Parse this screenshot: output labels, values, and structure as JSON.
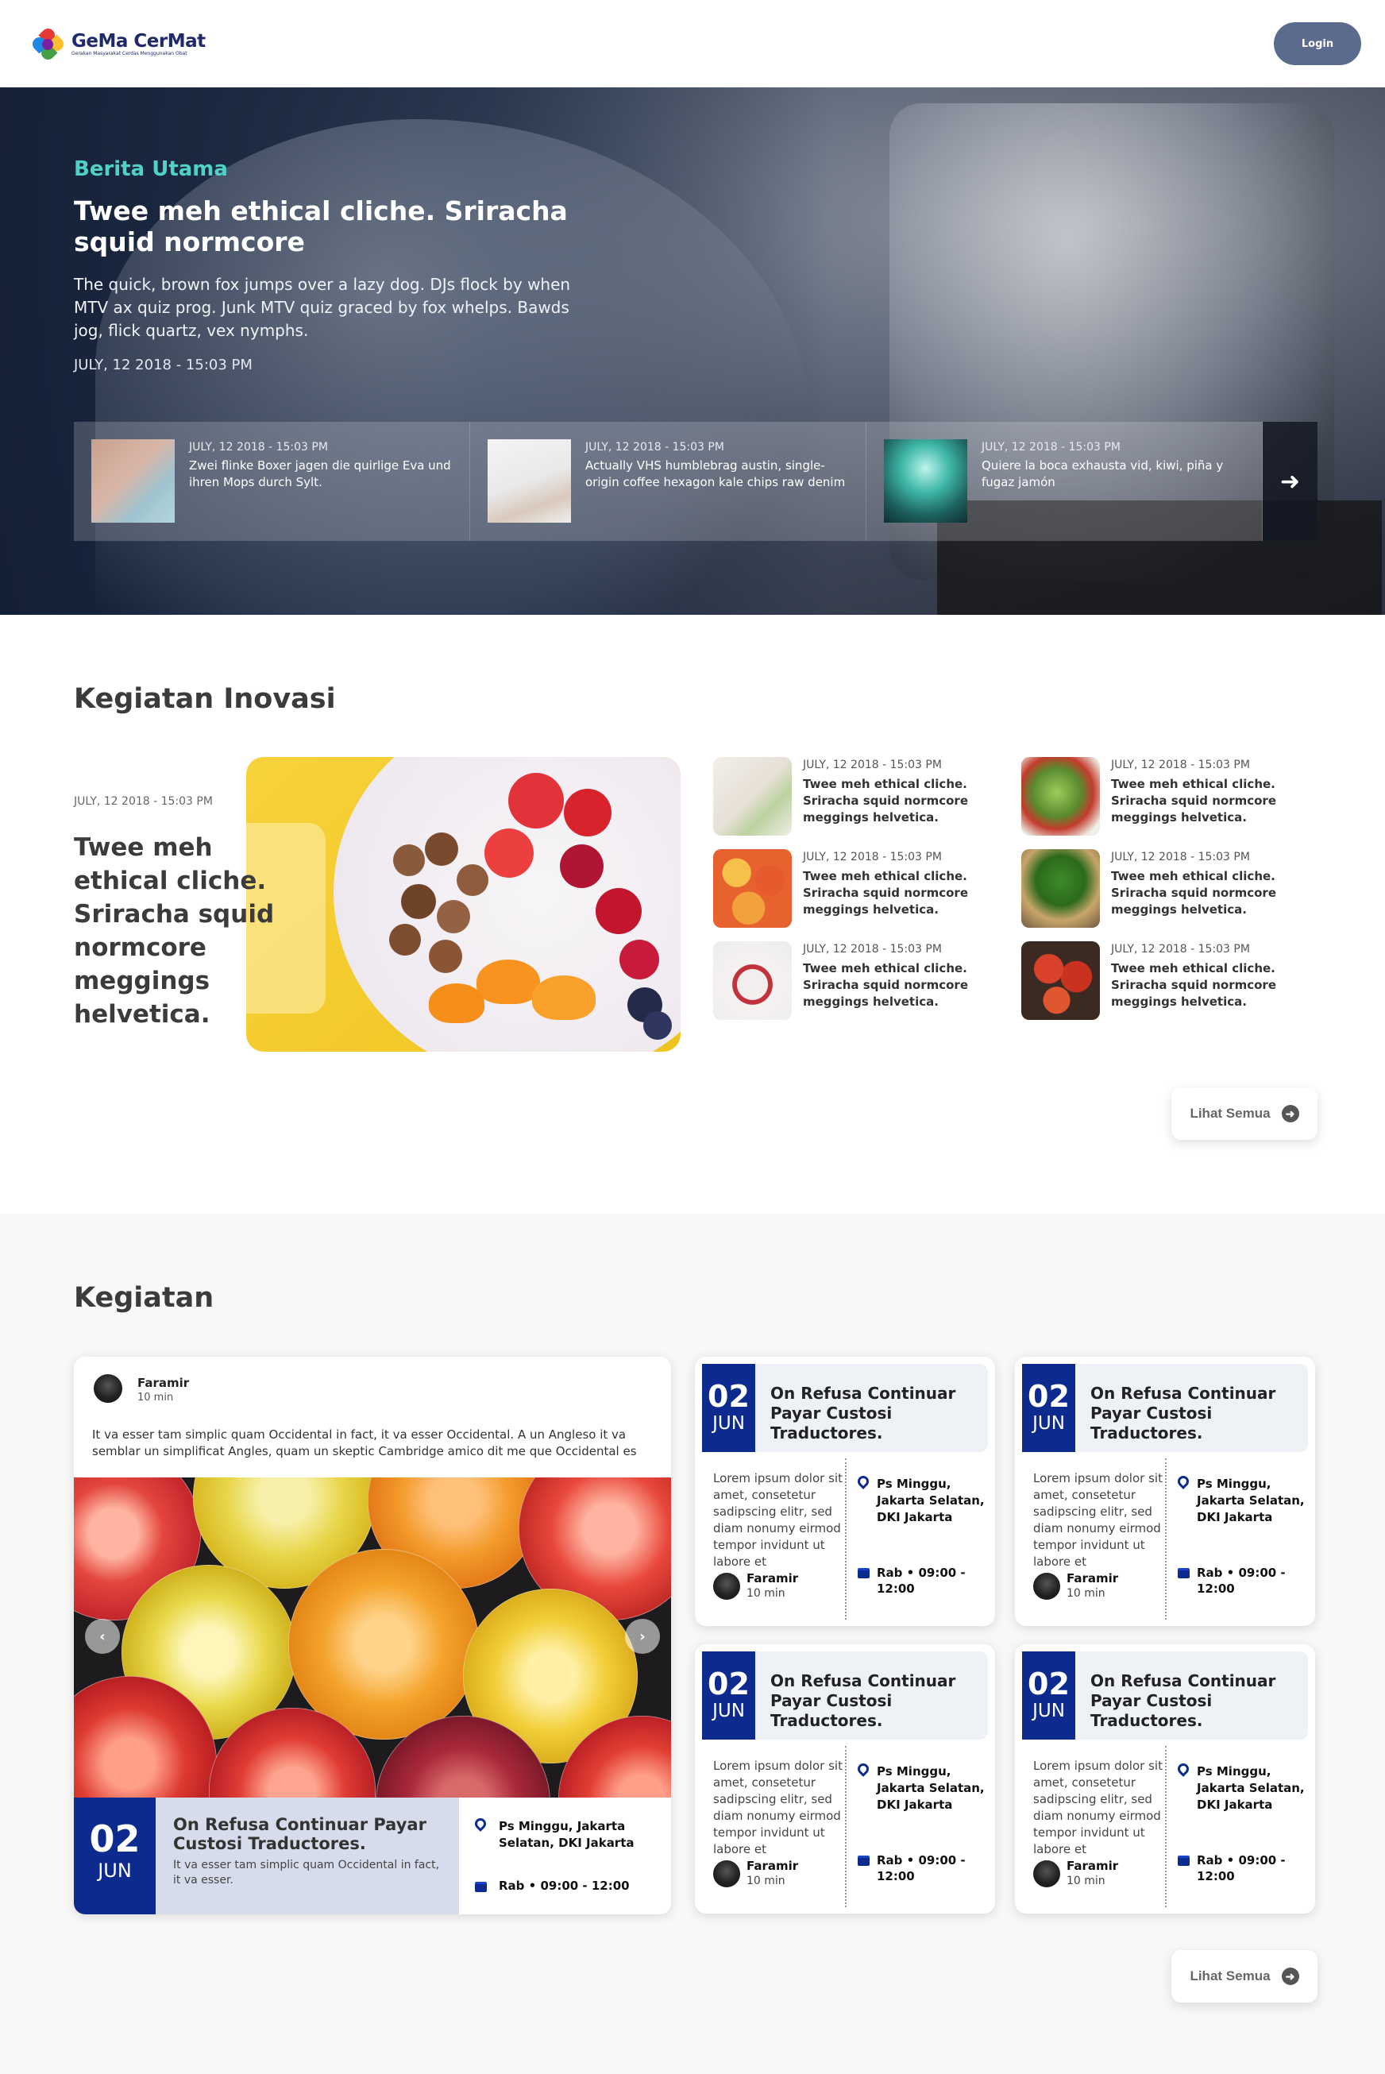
{
  "header": {
    "logo_name": "GeMa CerMat",
    "logo_tagline": "Gerakan Masyarakat Cerdas Menggunakan Obat",
    "login_label": "Login"
  },
  "hero": {
    "kicker": "Berita Utama",
    "title": "Twee meh ethical cliche. Sriracha squid normcore",
    "description": "The quick, brown fox jumps over a lazy dog. DJs flock by when MTV ax quiz prog. Junk MTV quiz graced by fox whelps. Bawds jog, flick quartz, vex nymphs.",
    "date": "JULY, 12 2018 - 15:03 PM",
    "strip": [
      {
        "date": "JULY, 12 2018 - 15:03 PM",
        "text": "Zwei flinke Boxer jagen die quirlige Eva und ihren Mops durch Sylt."
      },
      {
        "date": "JULY, 12 2018 - 15:03 PM",
        "text": "Actually VHS humblebrag austin, single-origin coffee hexagon kale chips raw denim"
      },
      {
        "date": "JULY, 12 2018 - 15:03 PM",
        "text": "Quiere la boca exhausta vid, kiwi, piña y fugaz jamón"
      }
    ],
    "next_icon": "arrow-right-icon"
  },
  "inovasi": {
    "title": "Kegiatan Inovasi",
    "featured": {
      "date": "JULY, 12 2018 - 15:03 PM",
      "title": "Twee meh ethical cliche. Sriracha squid normcore meggings helvetica."
    },
    "items": [
      {
        "date": "JULY, 12 2018 - 15:03 PM",
        "text": "Twee meh ethical cliche. Sriracha squid normcore meggings helvetica."
      },
      {
        "date": "JULY, 12 2018 - 15:03 PM",
        "text": "Twee meh ethical cliche. Sriracha squid normcore meggings helvetica."
      },
      {
        "date": "JULY, 12 2018 - 15:03 PM",
        "text": "Twee meh ethical cliche. Sriracha squid normcore meggings helvetica."
      },
      {
        "date": "JULY, 12 2018 - 15:03 PM",
        "text": "Twee meh ethical cliche. Sriracha squid normcore meggings helvetica."
      },
      {
        "date": "JULY, 12 2018 - 15:03 PM",
        "text": "Twee meh ethical cliche. Sriracha squid normcore meggings helvetica."
      },
      {
        "date": "JULY, 12 2018 - 15:03 PM",
        "text": "Twee meh ethical cliche. Sriracha squid normcore meggings helvetica."
      }
    ],
    "see_all": "Lihat Semua"
  },
  "kegiatan": {
    "title": "Kegiatan",
    "featured": {
      "author": "Faramir",
      "read_time": "10 min",
      "text": "It va esser tam simplic quam Occidental in fact, it va esser Occidental. A un Angleso it va semblar un simplificat Angles, quam un skeptic Cambridge amico dit me que Occidental es",
      "day": "02",
      "month": "JUN",
      "event_title": "On Refusa Continuar Payar Custosi Traductores.",
      "event_sub": "It va esser tam simplic quam Occidental in fact, it va esser.",
      "location": "Ps Minggu, Jakarta Selatan, DKI Jakarta",
      "time": "Rab • 09:00 - 12:00"
    },
    "events": [
      {
        "day": "02",
        "month": "JUN",
        "title": "On Refusa Continuar Payar Custosi Traductores.",
        "desc": "Lorem ipsum dolor sit amet, consetetur sadipscing elitr, sed diam nonumy eirmod tempor invidunt ut labore et",
        "author": "Faramir",
        "read_time": "10 min",
        "location": "Ps Minggu, Jakarta Selatan, DKI Jakarta",
        "time": "Rab • 09:00 - 12:00"
      },
      {
        "day": "02",
        "month": "JUN",
        "title": "On Refusa Continuar Payar Custosi Traductores.",
        "desc": "Lorem ipsum dolor sit amet, consetetur sadipscing elitr, sed diam nonumy eirmod tempor invidunt ut labore et",
        "author": "Faramir",
        "read_time": "10 min",
        "location": "Ps Minggu, Jakarta Selatan, DKI Jakarta",
        "time": "Rab • 09:00 - 12:00"
      },
      {
        "day": "02",
        "month": "JUN",
        "title": "On Refusa Continuar Payar Custosi Traductores.",
        "desc": "Lorem ipsum dolor sit amet, consetetur sadipscing elitr, sed diam nonumy eirmod tempor invidunt ut labore et",
        "author": "Faramir",
        "read_time": "10 min",
        "location": "Ps Minggu, Jakarta Selatan, DKI Jakarta",
        "time": "Rab • 09:00 - 12:00"
      },
      {
        "day": "02",
        "month": "JUN",
        "title": "On Refusa Continuar Payar Custosi Traductores.",
        "desc": "Lorem ipsum dolor sit amet, consetetur sadipscing elitr, sed diam nonumy eirmod tempor invidunt ut labore et",
        "author": "Faramir",
        "read_time": "10 min",
        "location": "Ps Minggu, Jakarta Selatan, DKI Jakarta",
        "time": "Rab • 09:00 - 12:00"
      }
    ],
    "see_all": "Lihat Semua"
  },
  "colors": {
    "accent_teal": "#4fd1c5",
    "brand_navy": "#0d2a8f",
    "login_bg": "#5b6b8e"
  }
}
